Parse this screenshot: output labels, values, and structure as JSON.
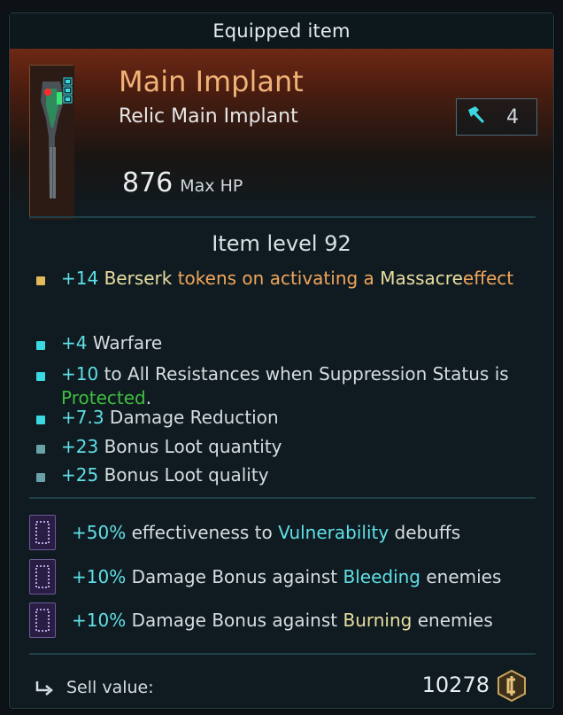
{
  "tooltip": {
    "title": "Equipped item",
    "item_name": "Main Implant",
    "item_subtitle": "Relic Main Implant",
    "upgrade_level": "4",
    "hp_value": "876",
    "hp_label": "Max HP",
    "item_level": "Item level 92",
    "stats": [
      {
        "bullet_color": "#e0b95a",
        "parts": [
          {
            "text": "+14 ",
            "style": "teal"
          },
          {
            "text": "Berserk",
            "style": "yellow"
          },
          {
            "text": " tokens on activating a ",
            "style": "orange"
          },
          {
            "text": "Massacre",
            "style": "yellow"
          },
          {
            "text": "effect",
            "style": "orange"
          }
        ]
      },
      {
        "bullet_color": "#3ad8e0",
        "parts": [
          {
            "text": "+4 ",
            "style": "teal"
          },
          {
            "text": "Warfare",
            "style": "white"
          }
        ]
      },
      {
        "bullet_color": "#3ad8e0",
        "parts": [
          {
            "text": "+10 ",
            "style": "teal"
          },
          {
            "text": "to All Resistances when Suppression Status is ",
            "style": "white"
          },
          {
            "text": "Protected",
            "style": "green"
          },
          {
            "text": ".",
            "style": "white"
          }
        ]
      },
      {
        "bullet_color": "#3ad8e0",
        "parts": [
          {
            "text": "+7.3 ",
            "style": "teal"
          },
          {
            "text": "Damage Reduction",
            "style": "white"
          }
        ]
      },
      {
        "bullet_color": "#6aa0a8",
        "parts": [
          {
            "text": "+23 ",
            "style": "teal"
          },
          {
            "text": "Bonus Loot quantity",
            "style": "white"
          }
        ]
      },
      {
        "bullet_color": "#6aa0a8",
        "parts": [
          {
            "text": "+25 ",
            "style": "teal"
          },
          {
            "text": "Bonus Loot quality",
            "style": "white"
          }
        ]
      }
    ],
    "runes": [
      {
        "parts": [
          {
            "text": "+50% ",
            "style": "teal"
          },
          {
            "text": "effectiveness to ",
            "style": "white"
          },
          {
            "text": "Vulnerability",
            "style": "teal"
          },
          {
            "text": " debuffs",
            "style": "white"
          }
        ]
      },
      {
        "parts": [
          {
            "text": "+10% ",
            "style": "teal"
          },
          {
            "text": "Damage Bonus against ",
            "style": "white"
          },
          {
            "text": "Bleeding",
            "style": "teal"
          },
          {
            "text": " enemies",
            "style": "white"
          }
        ]
      },
      {
        "parts": [
          {
            "text": "+10% ",
            "style": "teal"
          },
          {
            "text": "Damage Bonus against ",
            "style": "white"
          },
          {
            "text": "Burning",
            "style": "yellow"
          },
          {
            "text": " enemies",
            "style": "white"
          }
        ]
      }
    ],
    "sell_label": "Sell value:",
    "sell_value": "10278"
  },
  "icons": {
    "item": "implant-icon",
    "upgrade": "hammer-icon",
    "sell": "return-arrow-icon",
    "currency": "credit-coin-icon",
    "rune": "rune-icon"
  },
  "colors": {
    "header_accent": "#6e2814",
    "item_name": "#f1b277",
    "stat_value": "#5fe0e6",
    "status_green": "#3fbf3f"
  }
}
